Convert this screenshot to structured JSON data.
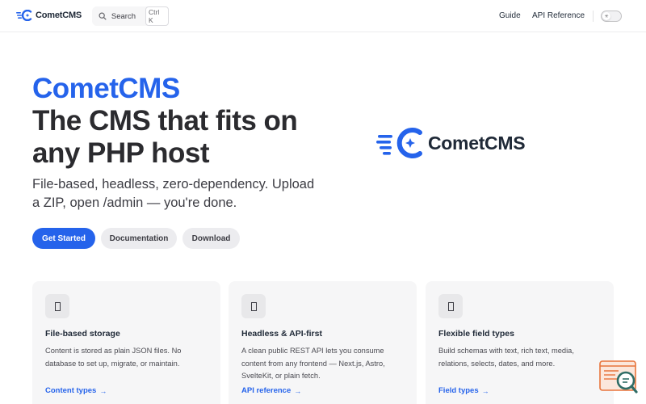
{
  "nav": {
    "brand": "CometCMS",
    "search_label": "Search",
    "search_shortcut": "Ctrl K",
    "links": [
      "Guide",
      "API Reference"
    ]
  },
  "hero": {
    "name": "CometCMS",
    "text": "The CMS that fits on any PHP host",
    "tagline": "File-based, headless, zero-dependency. Upload a ZIP, open /admin — you're done.",
    "actions": [
      "Get Started",
      "Documentation",
      "Download"
    ],
    "logo_text": "CometCMS"
  },
  "features": [
    {
      "title": "File-based storage",
      "details": "Content is stored as plain JSON files. No database to set up, migrate, or maintain.",
      "link": "Content types"
    },
    {
      "title": "Headless & API-first",
      "details": "A clean public REST API lets you consume content from any frontend — Next.js, Astro, SvelteKit, or plain fetch.",
      "link": "API reference"
    },
    {
      "title": "Flexible field types",
      "details": "Build schemas with text, rich text, media, relations, selects, dates, and more.",
      "link": "Field types"
    }
  ],
  "colors": {
    "brand": "#2563eb",
    "text": "#3c3c43",
    "heading": "#2b2b2f",
    "card_bg": "#f6f6f7",
    "widget_accent": "#e8743b"
  },
  "icons": {
    "brand": "comet-logo-icon",
    "search": "search-icon",
    "theme": "sun-icon",
    "feature": "feature-icon",
    "arrow": "arrow-right-icon",
    "widget": "search-doc-icon"
  }
}
